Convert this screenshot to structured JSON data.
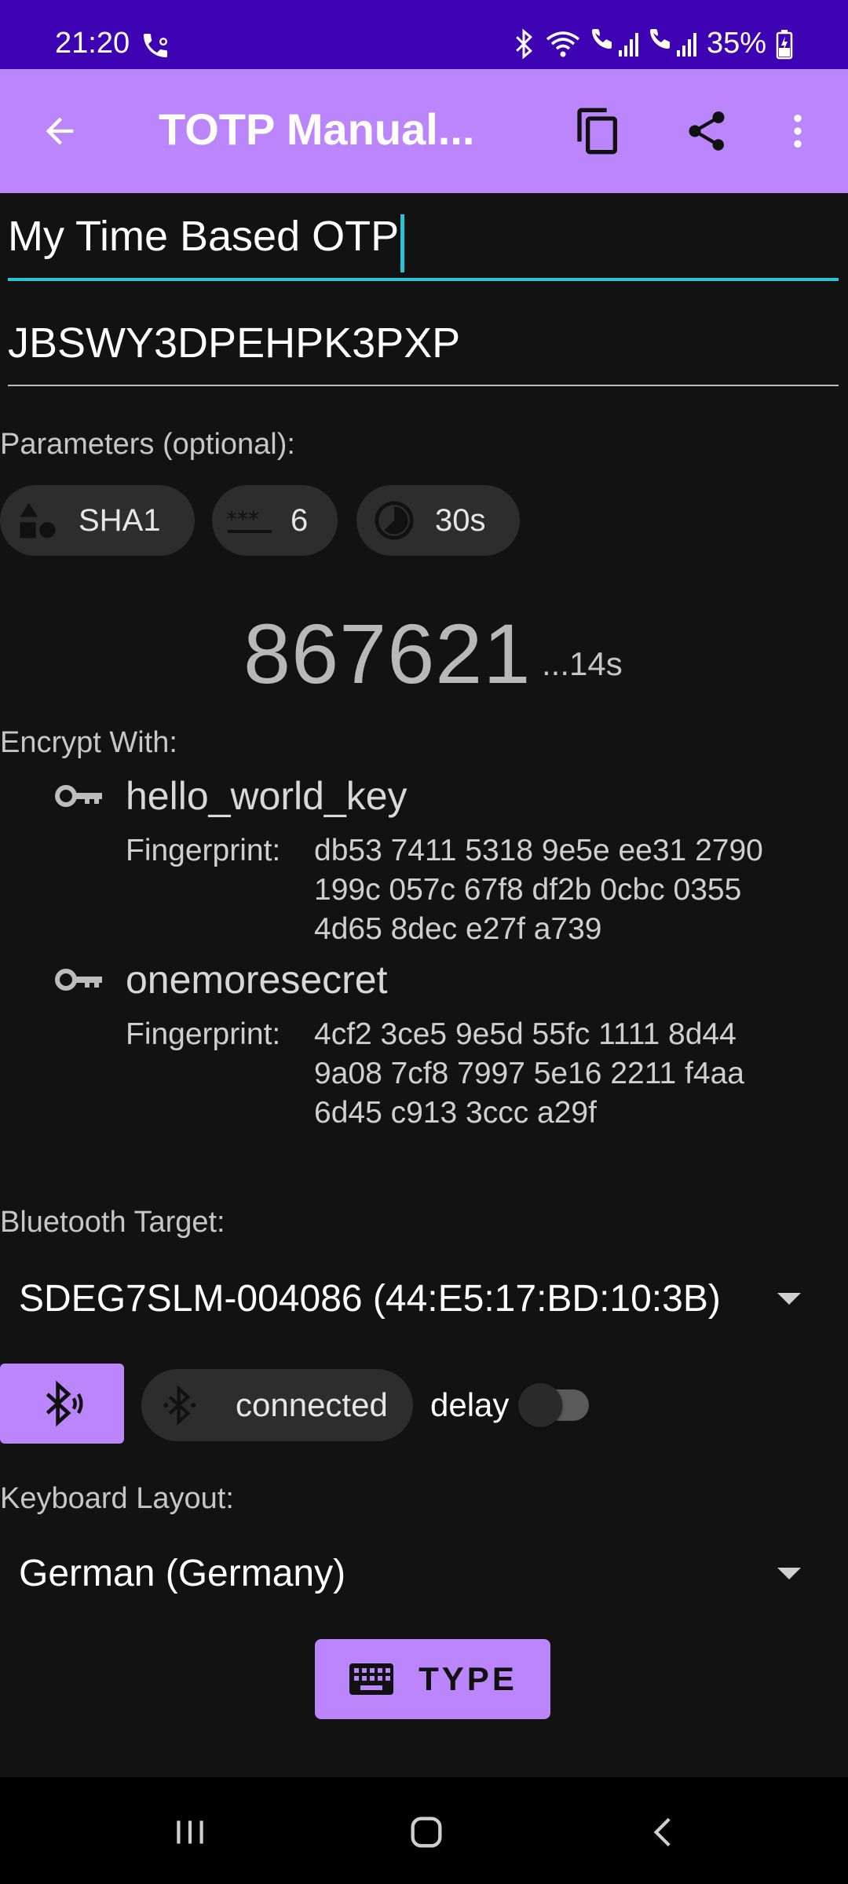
{
  "status_bar": {
    "time": "21:20",
    "battery": "35%",
    "icons": [
      "wifi-calling-icon",
      "bluetooth-icon",
      "wifi-icon",
      "sim1-signal-icon",
      "sim2-signal-icon",
      "battery-charging-icon"
    ]
  },
  "app_bar": {
    "title": "TOTP Manual...",
    "icons": [
      "back-arrow-icon",
      "copy-icon",
      "share-icon",
      "more-vert-icon"
    ]
  },
  "form": {
    "name_value": "My Time Based OTP",
    "secret_value": "JBSWY3DPEHPK3PXP"
  },
  "parameters": {
    "label": "Parameters (optional):",
    "algorithm": "SHA1",
    "digits": "6",
    "period": "30s"
  },
  "otp": {
    "code": "867621",
    "remaining": "...14s"
  },
  "encryption": {
    "label": "Encrypt With:",
    "keys": [
      {
        "name": "hello_world_key",
        "fingerprint_label": "Fingerprint:",
        "fingerprint_lines": [
          "db53 7411 5318 9e5e ee31 2790",
          "199c 057c 67f8 df2b 0cbc 0355",
          "4d65 8dec e27f a739"
        ]
      },
      {
        "name": "onemoresecret",
        "fingerprint_label": "Fingerprint:",
        "fingerprint_lines": [
          "4cf2 3ce5 9e5d 55fc 1111 8d44",
          "9a08 7cf8 7997 5e16 2211 f4aa",
          "6d45 c913 3ccc a29f"
        ]
      }
    ]
  },
  "bluetooth": {
    "label": "Bluetooth Target:",
    "selected_target": "SDEG7SLM-004086 (44:E5:17:BD:10:3B)",
    "status": "connected",
    "delay_label": "delay",
    "delay_enabled": false
  },
  "keyboard": {
    "label": "Keyboard Layout:",
    "selected_layout": "German (Germany)"
  },
  "actions": {
    "type_label": "TYPE"
  },
  "colors": {
    "status_bar": "#3e04b3",
    "app_bar": "#bb86fc",
    "accent": "#26c6da",
    "background": "#121212",
    "chip": "#2d2d2d"
  }
}
